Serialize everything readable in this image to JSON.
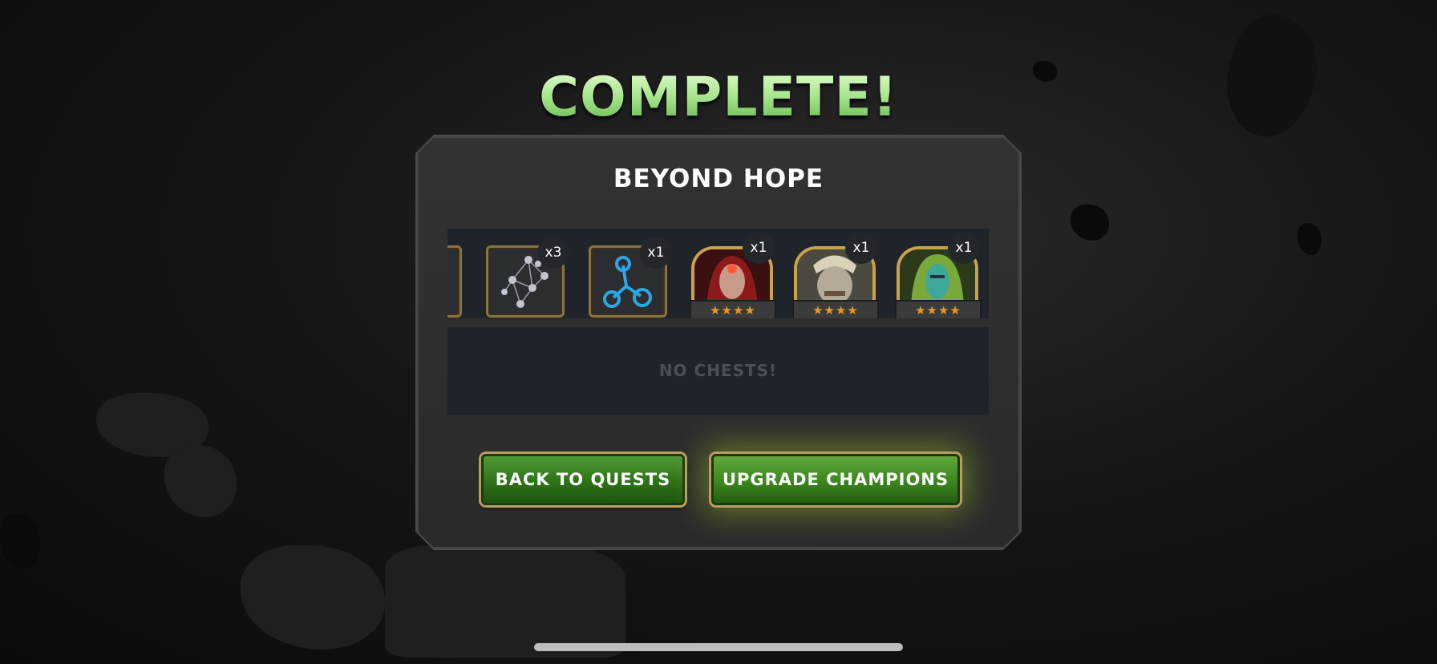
{
  "header": {
    "title": "COMPLETE!"
  },
  "quest": {
    "name": "BEYOND HOPE"
  },
  "rewards": [
    {
      "kind": "item",
      "icon": "crystal-lattice-icon",
      "qty": "x3"
    },
    {
      "kind": "item",
      "icon": "catalyst-molecule-icon",
      "qty": "x1"
    },
    {
      "kind": "champion",
      "icon": "red-hooded-champion-portrait",
      "qty": "x1",
      "stars": "★★★★"
    },
    {
      "kind": "champion",
      "icon": "horned-brute-champion-portrait",
      "qty": "x1",
      "stars": "★★★★"
    },
    {
      "kind": "champion",
      "icon": "green-hooded-champion-portrait",
      "qty": "x1",
      "stars": "★★★★"
    }
  ],
  "chests": {
    "empty_label": "NO CHESTS!"
  },
  "buttons": {
    "back_label": "BACK TO QUESTS",
    "upgrade_label": "UPGRADE CHAMPIONS"
  },
  "colors": {
    "title_green": "#a6e48a",
    "button_green": "#2e7218",
    "gold_frame": "#c9a24c",
    "star_orange": "#e59b27"
  }
}
